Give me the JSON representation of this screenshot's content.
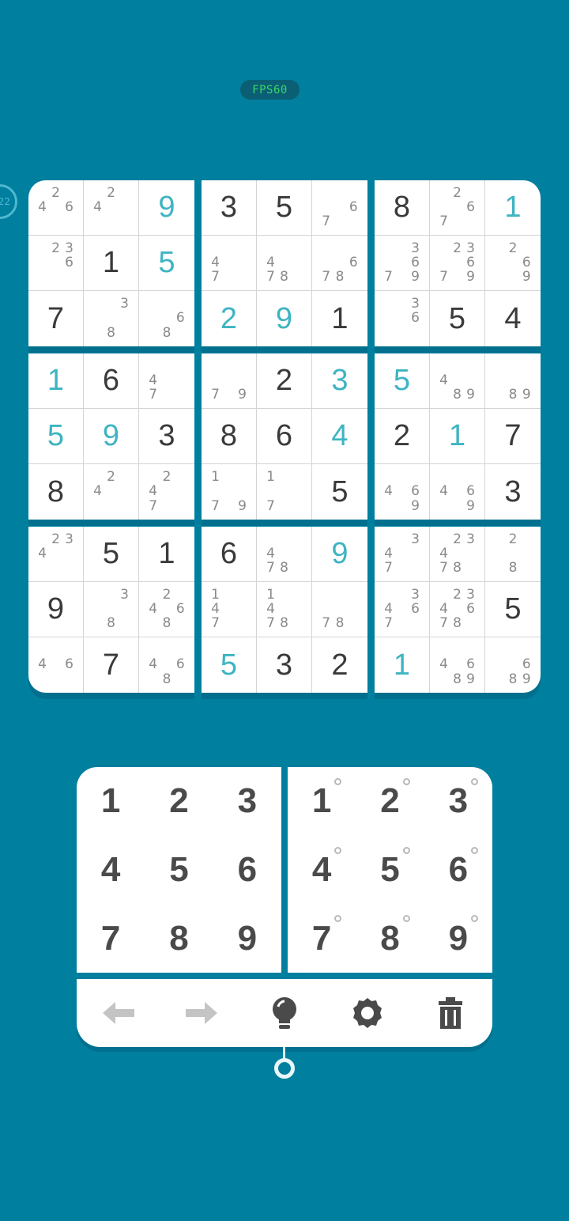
{
  "fps_label": "FPS60",
  "side_badge_text": "22",
  "colors": {
    "background": "#007f9f",
    "user_digit": "#3fb4c2",
    "given_digit": "#3a3a3a",
    "note_digit": "#8a8a8a"
  },
  "board": [
    [
      {
        "n": [
          "2",
          "4",
          "6"
        ]
      },
      {
        "n": [
          "2",
          "4"
        ]
      },
      {
        "v": "9",
        "u": true
      },
      {
        "v": "3"
      },
      {
        "v": "5"
      },
      {
        "n": [
          "6",
          "7"
        ]
      },
      {
        "v": "8"
      },
      {
        "n": [
          "2",
          "6",
          "7"
        ]
      },
      {
        "v": "1",
        "u": true
      }
    ],
    [
      {
        "n": [
          "2",
          "3",
          "6"
        ]
      },
      {
        "v": "1"
      },
      {
        "v": "5",
        "u": true
      },
      {
        "n": [
          "4",
          "7"
        ]
      },
      {
        "n": [
          "4",
          "7",
          "8"
        ]
      },
      {
        "n": [
          "6",
          "7",
          "8"
        ]
      },
      {
        "n": [
          "3",
          "6",
          "7",
          "9"
        ]
      },
      {
        "n": [
          "2",
          "3",
          "6",
          "7",
          "9"
        ]
      },
      {
        "n": [
          "2",
          "6",
          "9"
        ]
      }
    ],
    [
      {
        "v": "7"
      },
      {
        "n": [
          "3",
          "8"
        ]
      },
      {
        "n": [
          "6",
          "8"
        ]
      },
      {
        "v": "2",
        "u": true
      },
      {
        "v": "9",
        "u": true
      },
      {
        "v": "1"
      },
      {
        "n": [
          "3",
          "6"
        ]
      },
      {
        "v": "5"
      },
      {
        "v": "4"
      }
    ],
    [
      {
        "v": "1",
        "u": true
      },
      {
        "v": "6"
      },
      {
        "n": [
          "4",
          "7"
        ]
      },
      {
        "n": [
          "7",
          "9"
        ]
      },
      {
        "v": "2"
      },
      {
        "v": "3",
        "u": true
      },
      {
        "v": "5",
        "u": true
      },
      {
        "n": [
          "4",
          "8",
          "9"
        ]
      },
      {
        "n": [
          "8",
          "9"
        ]
      }
    ],
    [
      {
        "v": "5",
        "u": true
      },
      {
        "v": "9",
        "u": true
      },
      {
        "v": "3"
      },
      {
        "v": "8"
      },
      {
        "v": "6"
      },
      {
        "v": "4",
        "u": true
      },
      {
        "v": "2"
      },
      {
        "v": "1",
        "u": true
      },
      {
        "v": "7"
      }
    ],
    [
      {
        "v": "8"
      },
      {
        "n": [
          "2",
          "4"
        ]
      },
      {
        "n": [
          "2",
          "4",
          "7"
        ]
      },
      {
        "n": [
          "1",
          "7",
          "9"
        ]
      },
      {
        "n": [
          "1",
          "7"
        ]
      },
      {
        "v": "5"
      },
      {
        "n": [
          "4",
          "6",
          "9"
        ]
      },
      {
        "n": [
          "4",
          "6",
          "9"
        ]
      },
      {
        "v": "3"
      }
    ],
    [
      {
        "n": [
          "2",
          "3",
          "4"
        ]
      },
      {
        "v": "5"
      },
      {
        "v": "1"
      },
      {
        "v": "6"
      },
      {
        "n": [
          "4",
          "7",
          "8"
        ]
      },
      {
        "v": "9",
        "u": true
      },
      {
        "n": [
          "3",
          "4",
          "7"
        ]
      },
      {
        "n": [
          "2",
          "3",
          "4",
          "7",
          "8"
        ]
      },
      {
        "n": [
          "2",
          "8"
        ]
      }
    ],
    [
      {
        "v": "9"
      },
      {
        "n": [
          "3",
          "8"
        ]
      },
      {
        "n": [
          "2",
          "4",
          "6",
          "8"
        ]
      },
      {
        "n": [
          "1",
          "4",
          "7"
        ]
      },
      {
        "n": [
          "1",
          "4",
          "7",
          "8"
        ]
      },
      {
        "n": [
          "7",
          "8"
        ]
      },
      {
        "n": [
          "3",
          "4",
          "6",
          "7"
        ]
      },
      {
        "n": [
          "2",
          "3",
          "4",
          "6",
          "7",
          "8"
        ]
      },
      {
        "v": "5"
      }
    ],
    [
      {
        "n": [
          "4",
          "6"
        ]
      },
      {
        "v": "7"
      },
      {
        "n": [
          "4",
          "6",
          "8"
        ]
      },
      {
        "v": "5",
        "u": true
      },
      {
        "v": "3"
      },
      {
        "v": "2"
      },
      {
        "v": "1",
        "u": true
      },
      {
        "n": [
          "4",
          "6",
          "8",
          "9"
        ]
      },
      {
        "n": [
          "6",
          "8",
          "9"
        ]
      }
    ]
  ],
  "number_pad": [
    "1",
    "2",
    "3",
    "4",
    "5",
    "6",
    "7",
    "8",
    "9"
  ],
  "notes_pad": [
    "1",
    "2",
    "3",
    "4",
    "5",
    "6",
    "7",
    "8",
    "9"
  ],
  "toolbar": [
    {
      "name": "undo-arrow-icon",
      "color": "#c4c4c4"
    },
    {
      "name": "redo-arrow-icon",
      "color": "#c4c4c4"
    },
    {
      "name": "lightbulb-hint-icon",
      "color": "#4a4a4a"
    },
    {
      "name": "gear-settings-icon",
      "color": "#4a4a4a"
    },
    {
      "name": "trash-erase-icon",
      "color": "#4a4a4a"
    }
  ]
}
